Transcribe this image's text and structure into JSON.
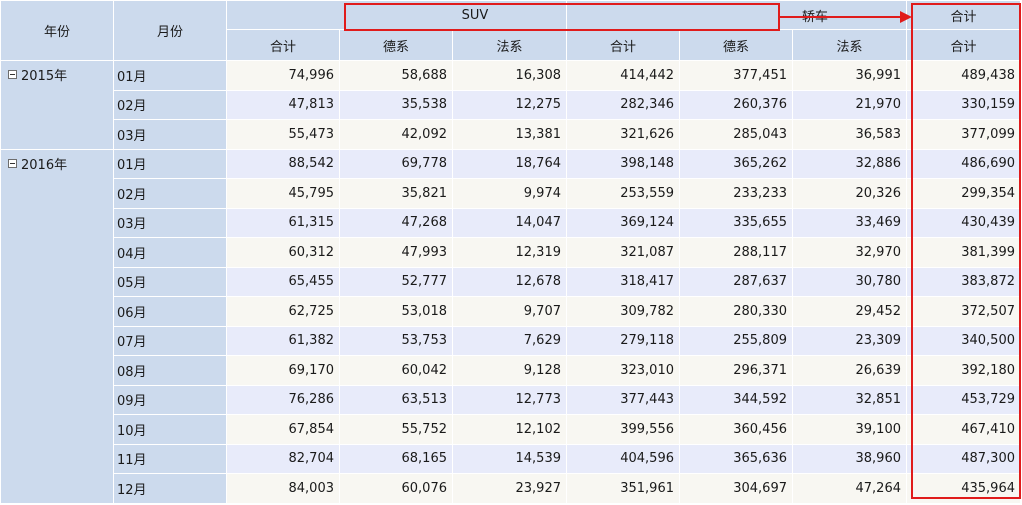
{
  "header": {
    "year_label": "年份",
    "month_label": "月份",
    "groups": [
      {
        "label": "SUV"
      },
      {
        "label": "轿车"
      },
      {
        "label": "合计"
      }
    ],
    "subcolumns": [
      "合计",
      "德系",
      "法系",
      "合计",
      "德系",
      "法系",
      "合计"
    ]
  },
  "years": [
    {
      "label": "2015年",
      "rows": [
        {
          "month": "01月",
          "values": [
            "74,996",
            "58,688",
            "16,308",
            "414,442",
            "377,451",
            "36,991",
            "489,438"
          ]
        },
        {
          "month": "02月",
          "values": [
            "47,813",
            "35,538",
            "12,275",
            "282,346",
            "260,376",
            "21,970",
            "330,159"
          ]
        },
        {
          "month": "03月",
          "values": [
            "55,473",
            "42,092",
            "13,381",
            "321,626",
            "285,043",
            "36,583",
            "377,099"
          ]
        }
      ]
    },
    {
      "label": "2016年",
      "rows": [
        {
          "month": "01月",
          "values": [
            "88,542",
            "69,778",
            "18,764",
            "398,148",
            "365,262",
            "32,886",
            "486,690"
          ]
        },
        {
          "month": "02月",
          "values": [
            "45,795",
            "35,821",
            "9,974",
            "253,559",
            "233,233",
            "20,326",
            "299,354"
          ]
        },
        {
          "month": "03月",
          "values": [
            "61,315",
            "47,268",
            "14,047",
            "369,124",
            "335,655",
            "33,469",
            "430,439"
          ]
        },
        {
          "month": "04月",
          "values": [
            "60,312",
            "47,993",
            "12,319",
            "321,087",
            "288,117",
            "32,970",
            "381,399"
          ]
        },
        {
          "month": "05月",
          "values": [
            "65,455",
            "52,777",
            "12,678",
            "318,417",
            "287,637",
            "30,780",
            "383,872"
          ]
        },
        {
          "month": "06月",
          "values": [
            "62,725",
            "53,018",
            "9,707",
            "309,782",
            "280,330",
            "29,452",
            "372,507"
          ]
        },
        {
          "month": "07月",
          "values": [
            "61,382",
            "53,753",
            "7,629",
            "279,118",
            "255,809",
            "23,309",
            "340,500"
          ]
        },
        {
          "month": "08月",
          "values": [
            "69,170",
            "60,042",
            "9,128",
            "323,010",
            "296,371",
            "26,639",
            "392,180"
          ]
        },
        {
          "month": "09月",
          "values": [
            "76,286",
            "63,513",
            "12,773",
            "377,443",
            "344,592",
            "32,851",
            "453,729"
          ]
        },
        {
          "month": "10月",
          "values": [
            "67,854",
            "55,752",
            "12,102",
            "399,556",
            "360,456",
            "39,100",
            "467,410"
          ]
        },
        {
          "month": "11月",
          "values": [
            "82,704",
            "68,165",
            "14,539",
            "404,596",
            "365,636",
            "38,960",
            "487,300"
          ]
        },
        {
          "month": "12月",
          "values": [
            "84,003",
            "60,076",
            "23,927",
            "351,961",
            "304,697",
            "47,264",
            "435,964"
          ]
        }
      ]
    }
  ],
  "annotations": {
    "color": "#e01b1b",
    "header_box_label": "SUV / 轿车 header highlight",
    "total_box_label": "合计 column highlight"
  },
  "colors": {
    "header_bg": "#ccdaed",
    "row_odd_bg": "#f8f7f2",
    "row_even_bg": "#e8ebfa"
  }
}
